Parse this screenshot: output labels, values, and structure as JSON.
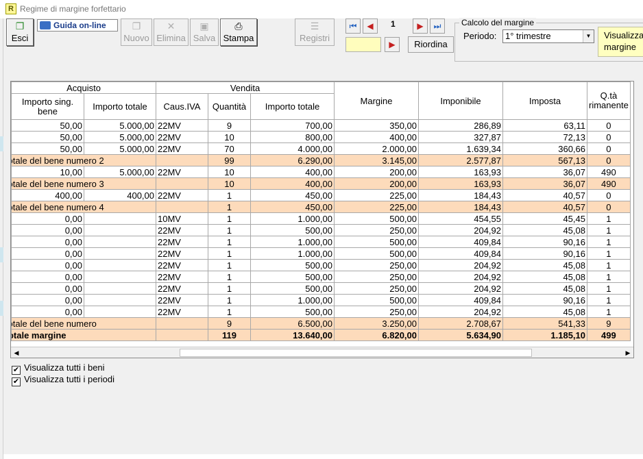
{
  "window": {
    "title": "Regime di margine forfettario"
  },
  "toolbar": {
    "esci": "Esci",
    "guida": "Guida on-line",
    "nuovo": "Nuovo",
    "elimina": "Elimina",
    "salva": "Salva",
    "stampa": "Stampa",
    "registri": "Registri"
  },
  "navigation": {
    "page": "1",
    "riordina": "Riordina"
  },
  "calcolo": {
    "legend": "Calcolo del margine",
    "periodo_label": "Periodo:",
    "periodo_value": "1° trimestre",
    "visualizza": "Visualizza margine"
  },
  "grid": {
    "group_headers": {
      "acquisto": "Acquisto",
      "vendita": "Vendita"
    },
    "columns": {
      "importo_sing": "Importo sing. bene",
      "importo_totale_acq": "Importo totale",
      "caus_iva": "Caus.IVA",
      "quantita": "Quantità",
      "importo_totale_vend": "Importo totale",
      "margine": "Margine",
      "imponibile": "Imponibile",
      "imposta": "Imposta",
      "qta_rimanente": "Q.tà rimanente"
    },
    "rows": [
      {
        "type": "data",
        "c": [
          "50,00",
          "5.000,00",
          "22MV",
          "9",
          "700,00",
          "350,00",
          "286,89",
          "63,11",
          "0"
        ]
      },
      {
        "type": "data",
        "c": [
          "50,00",
          "5.000,00",
          "22MV",
          "10",
          "800,00",
          "400,00",
          "327,87",
          "72,13",
          "0"
        ]
      },
      {
        "type": "data",
        "c": [
          "50,00",
          "5.000,00",
          "22MV",
          "70",
          "4.000,00",
          "2.000,00",
          "1.639,34",
          "360,66",
          "0"
        ]
      },
      {
        "type": "total",
        "c": [
          "Totale del bene numero 2",
          "",
          "",
          "99",
          "6.290,00",
          "3.145,00",
          "2.577,87",
          "567,13",
          "0"
        ]
      },
      {
        "type": "data",
        "c": [
          "10,00",
          "5.000,00",
          "22MV",
          "10",
          "400,00",
          "200,00",
          "163,93",
          "36,07",
          "490"
        ]
      },
      {
        "type": "total",
        "c": [
          "Totale del bene numero 3",
          "",
          "",
          "10",
          "400,00",
          "200,00",
          "163,93",
          "36,07",
          "490"
        ]
      },
      {
        "type": "data",
        "c": [
          "400,00",
          "400,00",
          "22MV",
          "1",
          "450,00",
          "225,00",
          "184,43",
          "40,57",
          "0"
        ]
      },
      {
        "type": "total",
        "c": [
          "Totale del bene numero 4",
          "",
          "",
          "1",
          "450,00",
          "225,00",
          "184,43",
          "40,57",
          "0"
        ]
      },
      {
        "type": "data",
        "c": [
          "0,00",
          "",
          "10MV",
          "1",
          "1.000,00",
          "500,00",
          "454,55",
          "45,45",
          "1"
        ]
      },
      {
        "type": "data",
        "c": [
          "0,00",
          "",
          "22MV",
          "1",
          "500,00",
          "250,00",
          "204,92",
          "45,08",
          "1"
        ]
      },
      {
        "type": "data",
        "c": [
          "0,00",
          "",
          "22MV",
          "1",
          "1.000,00",
          "500,00",
          "409,84",
          "90,16",
          "1"
        ]
      },
      {
        "type": "data",
        "c": [
          "0,00",
          "",
          "22MV",
          "1",
          "1.000,00",
          "500,00",
          "409,84",
          "90,16",
          "1"
        ]
      },
      {
        "type": "data",
        "c": [
          "0,00",
          "",
          "22MV",
          "1",
          "500,00",
          "250,00",
          "204,92",
          "45,08",
          "1"
        ]
      },
      {
        "type": "data",
        "c": [
          "0,00",
          "",
          "22MV",
          "1",
          "500,00",
          "250,00",
          "204,92",
          "45,08",
          "1"
        ]
      },
      {
        "type": "data",
        "c": [
          "0,00",
          "",
          "22MV",
          "1",
          "500,00",
          "250,00",
          "204,92",
          "45,08",
          "1"
        ]
      },
      {
        "type": "data",
        "c": [
          "0,00",
          "",
          "22MV",
          "1",
          "1.000,00",
          "500,00",
          "409,84",
          "90,16",
          "1"
        ]
      },
      {
        "type": "data",
        "c": [
          "0,00",
          "",
          "22MV",
          "1",
          "500,00",
          "250,00",
          "204,92",
          "45,08",
          "1"
        ]
      },
      {
        "type": "total",
        "c": [
          "Totale del bene numero",
          "",
          "",
          "9",
          "6.500,00",
          "3.250,00",
          "2.708,67",
          "541,33",
          "9"
        ]
      },
      {
        "type": "grand",
        "c": [
          "Totale margine",
          "",
          "",
          "119",
          "13.640,00",
          "6.820,00",
          "5.634,90",
          "1.185,10",
          "499"
        ]
      }
    ]
  },
  "options": {
    "tutti_beni": {
      "label": "Visualizza tutti i beni",
      "checked": true
    },
    "tutti_periodi": {
      "label": "Visualizza tutti i periodi",
      "checked": true
    }
  },
  "colors": {
    "total_row": "#fddbbb",
    "goto_field": "#fffdbd",
    "visualizza_button": "#ffffc0"
  }
}
